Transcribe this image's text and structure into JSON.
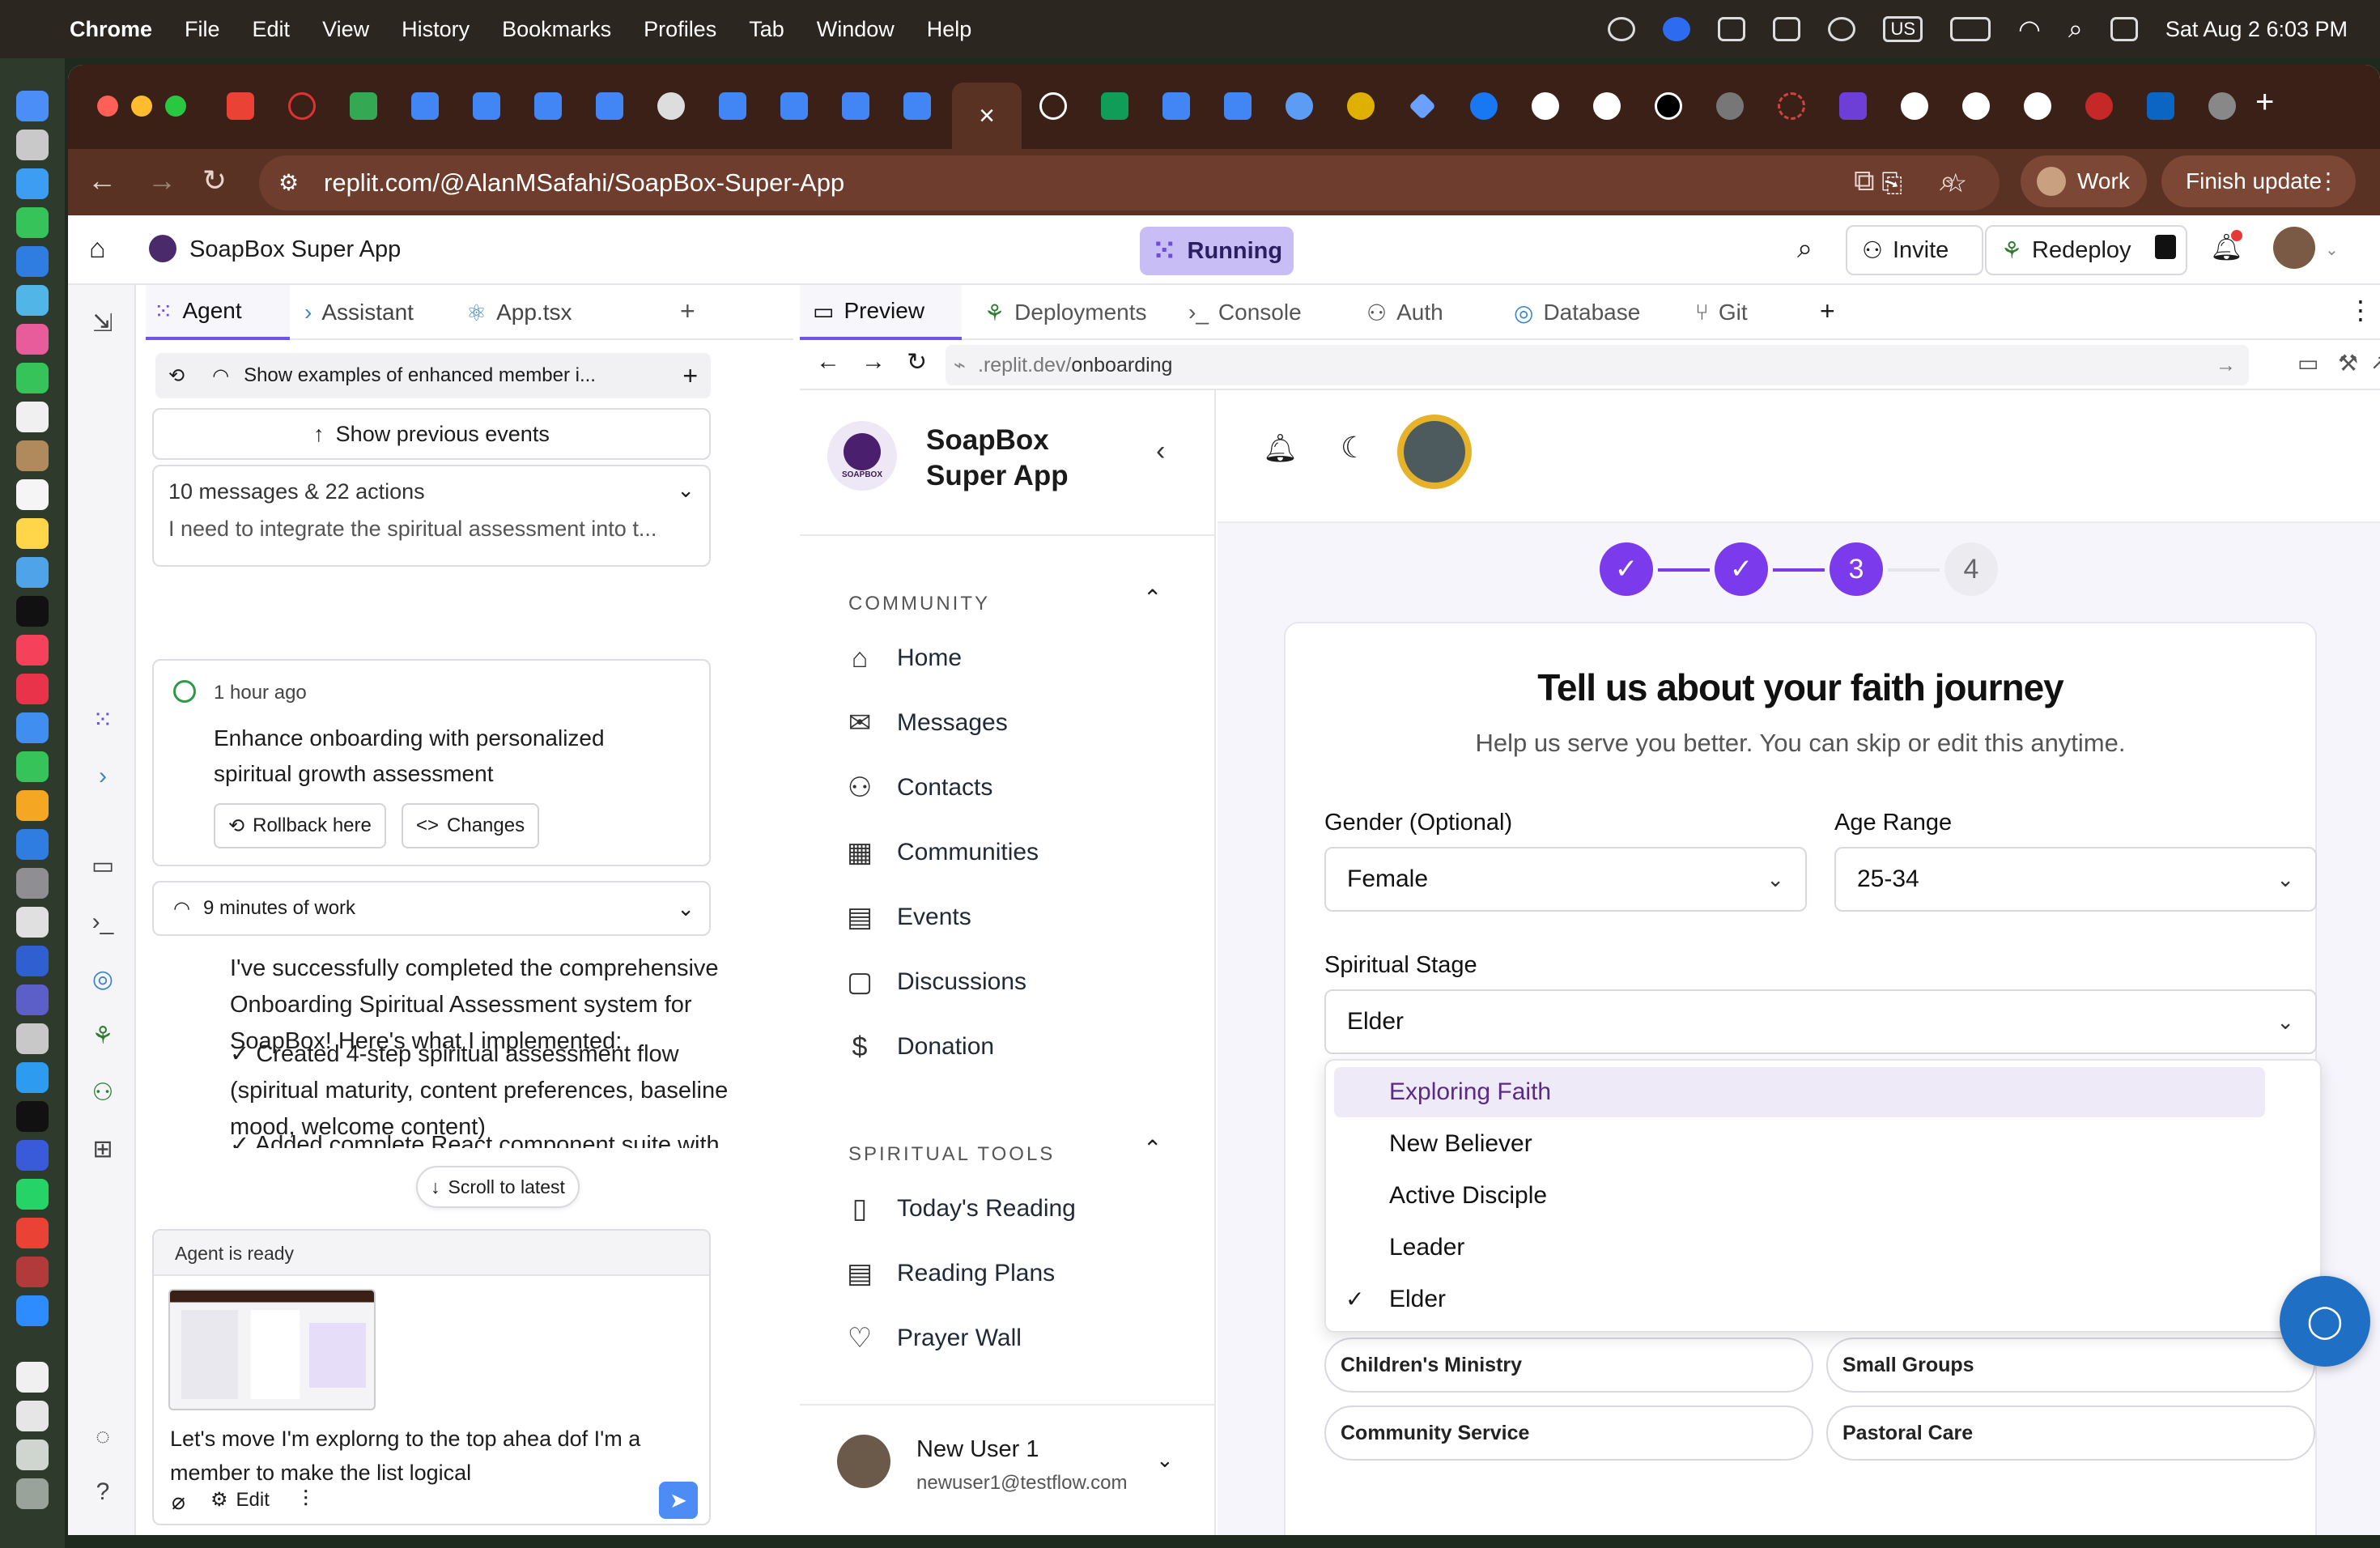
{
  "menubar": {
    "app": "Chrome",
    "items": [
      "File",
      "Edit",
      "View",
      "History",
      "Bookmarks",
      "Profiles",
      "Tab",
      "Window",
      "Help"
    ],
    "input_source": "US",
    "datetime": "Sat Aug 2  6:03 PM"
  },
  "browser": {
    "url": "replit.com/@AlanMSafahi/SoapBox-Super-App",
    "profile": "Work",
    "finish_update": "Finish update"
  },
  "replit": {
    "project_name": "SoapBox Super App",
    "status": "Running",
    "invite": "Invite",
    "redeploy": "Redeploy",
    "left_tabs": [
      "Agent",
      "Assistant",
      "App.tsx"
    ],
    "right_tabs": [
      "Preview",
      "Deployments",
      "Console",
      "Auth",
      "Database",
      "Git"
    ]
  },
  "agent": {
    "thread_title": "Show examples of enhanced member i...",
    "show_previous": "Show previous events",
    "summary_title": "10 messages & 22 actions",
    "summary_text": "I need to integrate the spiritual assessment into t...",
    "checkpoint_time": "1 hour ago",
    "checkpoint_title": "Enhance onboarding with personalized spiritual growth assessment",
    "rollback": "Rollback here",
    "changes": "Changes",
    "work_time": "9 minutes of work",
    "message_p1": "I've successfully completed the comprehensive Onboarding Spiritual Assessment system for SoapBox! Here's what I implemented:",
    "message_p2": "✓ Created 4-step spiritual assessment flow (spiritual maturity, content preferences, baseline mood, welcome content)",
    "message_p3": "✓ Added complete React component suite with",
    "scroll_latest": "Scroll to latest",
    "ready": "Agent is ready",
    "input_text": "Let's move I'm explorng to the top ahea dof I'm a member to make the list logical",
    "edit": "Edit"
  },
  "preview": {
    "url_prefix": ".replit.dev/",
    "url_path": "onboarding"
  },
  "app": {
    "brand_line1": "SoapBox",
    "brand_line2": "Super App",
    "logo_text": "SOAPBOX",
    "community_label": "COMMUNITY",
    "community_items": [
      {
        "label": "Home",
        "icon": "home-icon"
      },
      {
        "label": "Messages",
        "icon": "mail-icon"
      },
      {
        "label": "Contacts",
        "icon": "user-plus-icon"
      },
      {
        "label": "Communities",
        "icon": "building-icon"
      },
      {
        "label": "Events",
        "icon": "calendar-icon"
      },
      {
        "label": "Discussions",
        "icon": "chat-icon"
      },
      {
        "label": "Donation",
        "icon": "dollar-icon"
      }
    ],
    "tools_label": "SPIRITUAL TOOLS",
    "tools_items": [
      {
        "label": "Today's Reading",
        "icon": "book-icon"
      },
      {
        "label": "Reading Plans",
        "icon": "calendar-icon"
      },
      {
        "label": "Prayer Wall",
        "icon": "heart-icon"
      }
    ],
    "user_name": "New User 1",
    "user_email": "newuser1@testflow.com",
    "steps": [
      "3",
      "4"
    ],
    "form_title": "Tell us about your faith journey",
    "form_subtitle": "Help us serve you better. You can skip or edit this anytime.",
    "gender_label": "Gender (Optional)",
    "gender_value": "Female",
    "age_label": "Age Range",
    "age_value": "25-34",
    "stage_label": "Spiritual Stage",
    "stage_value": "Elder",
    "stage_options": [
      "Exploring Faith",
      "New Believer",
      "Active Disciple",
      "Leader",
      "Elder"
    ],
    "interests": [
      "Children's Ministry",
      "Small Groups",
      "Community Service",
      "Pastoral Care"
    ]
  },
  "colors": {
    "accent": "#7c3aed",
    "running_bg": "#c9bdf5",
    "browser_chrome": "#5a3224"
  }
}
